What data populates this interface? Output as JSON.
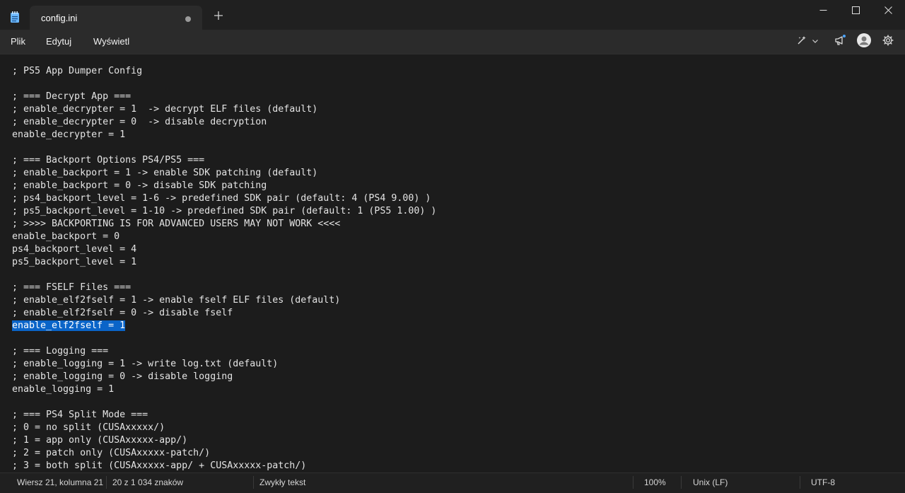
{
  "tab": {
    "title": "config.ini"
  },
  "menu": {
    "file": "Plik",
    "edit": "Edytuj",
    "view": "Wyświetl"
  },
  "editor": {
    "lines": [
      "; PS5 App Dumper Config",
      "",
      "; === Decrypt App ===",
      "; enable_decrypter = 1  -> decrypt ELF files (default)",
      "; enable_decrypter = 0  -> disable decryption",
      "enable_decrypter = 1",
      "",
      "; === Backport Options PS4/PS5 ===",
      "; enable_backport = 1 -> enable SDK patching (default)",
      "; enable_backport = 0 -> disable SDK patching",
      "; ps4_backport_level = 1-6 -> predefined SDK pair (default: 4 (PS4 9.00) )",
      "; ps5_backport_level = 1-10 -> predefined SDK pair (default: 1 (PS5 1.00) )",
      "; >>>> BACKPORTING IS FOR ADVANCED USERS MAY NOT WORK <<<<",
      "enable_backport = 0",
      "ps4_backport_level = 4",
      "ps5_backport_level = 1",
      "",
      "; === FSELF Files ===",
      "; enable_elf2fself = 1 -> enable fself ELF files (default)",
      "; enable_elf2fself = 0 -> disable fself",
      "enable_elf2fself = 1",
      "",
      "; === Logging ===",
      "; enable_logging = 1 -> write log.txt (default)",
      "; enable_logging = 0 -> disable logging",
      "enable_logging = 1",
      "",
      "; === PS4 Split Mode ===",
      "; 0 = no split (CUSAxxxxx/)",
      "; 1 = app only (CUSAxxxxx-app/)",
      "; 2 = patch only (CUSAxxxxx-patch/)",
      "; 3 = both split (CUSAxxxxx-app/ + CUSAxxxxx-patch/)"
    ],
    "selected_line": 20
  },
  "status": {
    "position": "Wiersz 21, kolumna 21",
    "selection": "20 z 1 034 znaków",
    "format": "Zwykły tekst",
    "zoom": "100%",
    "line_ending": "Unix (LF)",
    "encoding": "UTF-8"
  },
  "colors": {
    "accent": "#0a64c8",
    "background": "#1c1c1c",
    "menubar": "#2b2b2b"
  },
  "icons": [
    "notepad-icon",
    "close-tab-dot-icon",
    "plus-icon",
    "minimize-icon",
    "maximize-icon",
    "close-icon",
    "copilot-icon",
    "chevron-down-icon",
    "announcement-icon",
    "account-icon",
    "gear-icon"
  ]
}
